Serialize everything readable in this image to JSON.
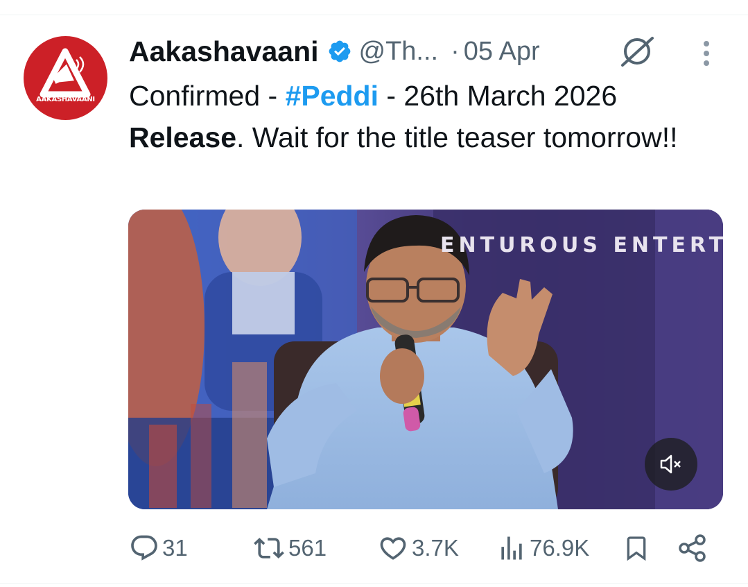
{
  "tweet": {
    "avatar_text": "AAKASHAVAANI",
    "display_name": "Aakashavaani",
    "handle": "@Th...",
    "separator": "·",
    "date": "05 Apr",
    "text": {
      "part1": "Confirmed - ",
      "hashtag": "#Peddi",
      "part2": " - 26th March 2026",
      "bold": "Release",
      "part3": ". Wait for the title teaser tomorrow!!"
    },
    "media": {
      "banner_text": "ENTUROUS ENTERT"
    }
  },
  "actions": {
    "replies": "31",
    "reposts": "561",
    "likes": "3.7K",
    "views": "76.9K"
  },
  "colors": {
    "brand_red": "#cc2027",
    "link_blue": "#1d9bf0",
    "secondary_text": "#536471"
  },
  "icons": [
    "verified-badge-icon",
    "grok-icon",
    "more-options-icon",
    "mute-icon",
    "reply-icon",
    "repost-icon",
    "like-icon",
    "views-icon",
    "bookmark-icon",
    "share-icon"
  ]
}
